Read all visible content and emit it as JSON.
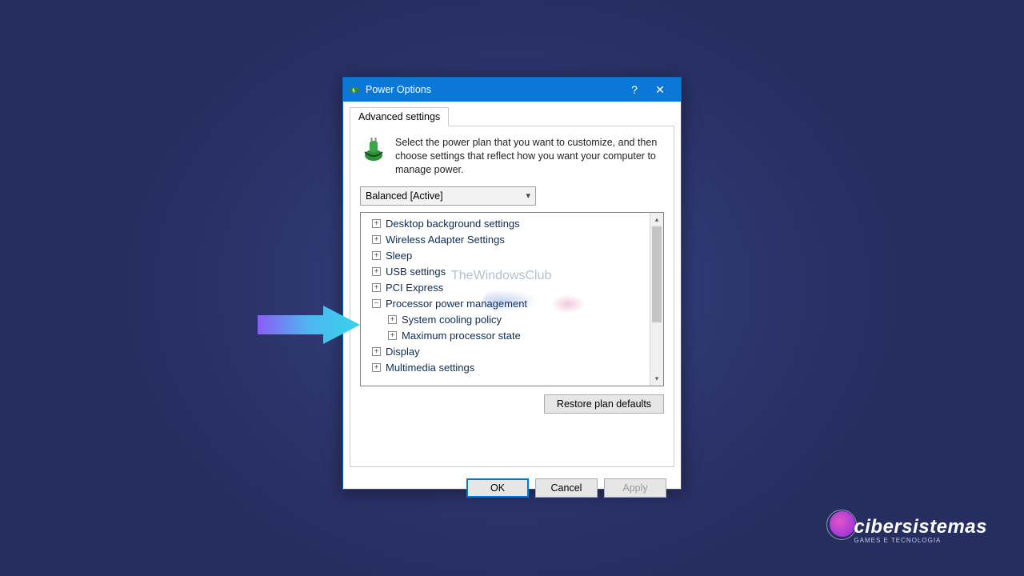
{
  "window": {
    "title": "Power Options",
    "help": "?",
    "close": "✕"
  },
  "tabs": {
    "active": "Advanced settings"
  },
  "intro": "Select the power plan that you want to customize, and then choose settings that reflect how you want your computer to manage power.",
  "plan": {
    "selected": "Balanced [Active]"
  },
  "tree": [
    {
      "expand": "+",
      "level": 1,
      "label": "Desktop background settings"
    },
    {
      "expand": "+",
      "level": 1,
      "label": "Wireless Adapter Settings"
    },
    {
      "expand": "+",
      "level": 1,
      "label": "Sleep"
    },
    {
      "expand": "+",
      "level": 1,
      "label": "USB settings"
    },
    {
      "expand": "+",
      "level": 1,
      "label": "PCI Express"
    },
    {
      "expand": "−",
      "level": 1,
      "label": "Processor power management"
    },
    {
      "expand": "+",
      "level": 2,
      "label": "System cooling policy"
    },
    {
      "expand": "+",
      "level": 2,
      "label": "Maximum processor state"
    },
    {
      "expand": "+",
      "level": 1,
      "label": "Display"
    },
    {
      "expand": "+",
      "level": 1,
      "label": "Multimedia settings"
    }
  ],
  "buttons": {
    "restore": "Restore plan defaults",
    "ok": "OK",
    "cancel": "Cancel",
    "apply": "Apply"
  },
  "watermark": "TheWindowsClub",
  "brand": {
    "name": "cibersistemas",
    "tag": "GAMES E TECNOLOGIA"
  }
}
